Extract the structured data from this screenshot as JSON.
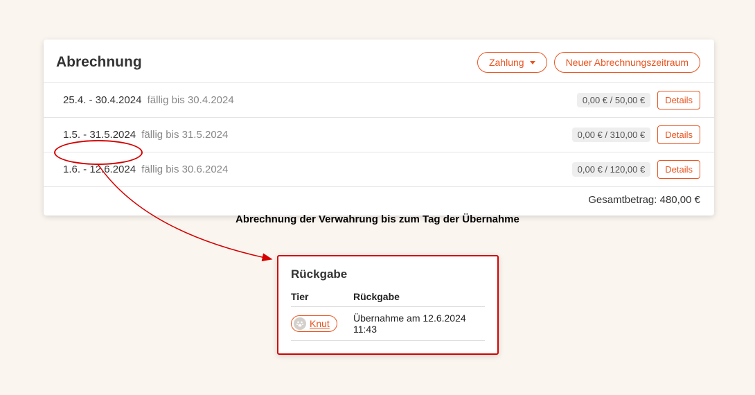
{
  "billing": {
    "title": "Abrechnung",
    "payment_label": "Zahlung",
    "new_period_label": "Neuer Abrechnungszeitraum",
    "periods": [
      {
        "range": "25.4. - 30.4.2024",
        "due_label": "fällig bis 30.4.2024",
        "amount": "0,00 € / 50,00 €",
        "details_label": "Details"
      },
      {
        "range": "1.5. - 31.5.2024",
        "due_label": "fällig bis 31.5.2024",
        "amount": "0,00 € / 310,00 €",
        "details_label": "Details"
      },
      {
        "range": "1.6. - 12.6.2024",
        "due_label": "fällig bis 30.6.2024",
        "amount": "0,00 € / 120,00 €",
        "details_label": "Details"
      }
    ],
    "total_label": "Gesamtbetrag: 480,00 €"
  },
  "annotation": "Abrechnung der Verwahrung bis zum Tag der Übernahme",
  "return_card": {
    "title": "Rückgabe",
    "col_tier": "Tier",
    "col_return": "Rückgabe",
    "animal_name": "Knut",
    "return_text": "Übernahme am 12.6.2024 11:43"
  }
}
